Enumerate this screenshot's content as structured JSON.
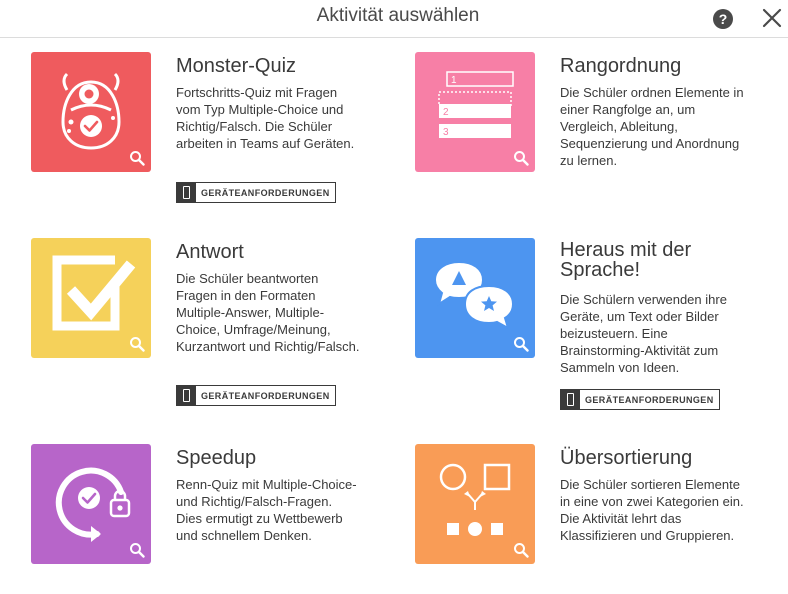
{
  "header": {
    "title": "Aktivität auswählen",
    "help_label": "?"
  },
  "device_requirements_label": "GERÄTEANFORDERUNGEN",
  "activities": {
    "monster": {
      "title": "Monster-Quiz",
      "description": "Fortschritts-Quiz mit Fragen vom Typ Multiple-Choice und Richtig/Falsch. Die Schüler arbeiten in Teams auf Geräten.",
      "color": "#ef5b5e"
    },
    "rang": {
      "title": "Rangordnung",
      "description": "Die Schüler ordnen Elemente in einer Rangfolge an, um Vergleich, Ableitung, Sequenzierung und Anordnung zu lernen.",
      "color": "#f77fa6",
      "slots": [
        "1",
        "2",
        "3"
      ]
    },
    "antwort": {
      "title": "Antwort",
      "description": "Die Schüler beantworten Fragen in den Formaten Multiple-Answer, Multiple-Choice, Umfrage/Meinung, Kurzantwort und Richtig/Falsch.",
      "color": "#f5d15a"
    },
    "sprache": {
      "title": "Heraus mit der Sprache!",
      "description": "Die Schülern verwenden ihre Geräte, um Text oder Bilder beizusteuern. Eine Brainstorming-Aktivität zum Sammeln von Ideen.",
      "color": "#4d95f0"
    },
    "speedup": {
      "title": "Speedup",
      "description": "Renn-Quiz mit Multiple-Choice- und Richtig/Falsch-Fragen. Dies ermutigt zu Wettbewerb und schnellem Denken.",
      "color": "#b765c9"
    },
    "sort": {
      "title": "Übersortierung",
      "description": "Die Schüler sortieren Elemente in eine von zwei Kategorien ein. Die Aktivität lehrt das Klassifizieren und Gruppieren.",
      "color": "#f99c56"
    }
  }
}
